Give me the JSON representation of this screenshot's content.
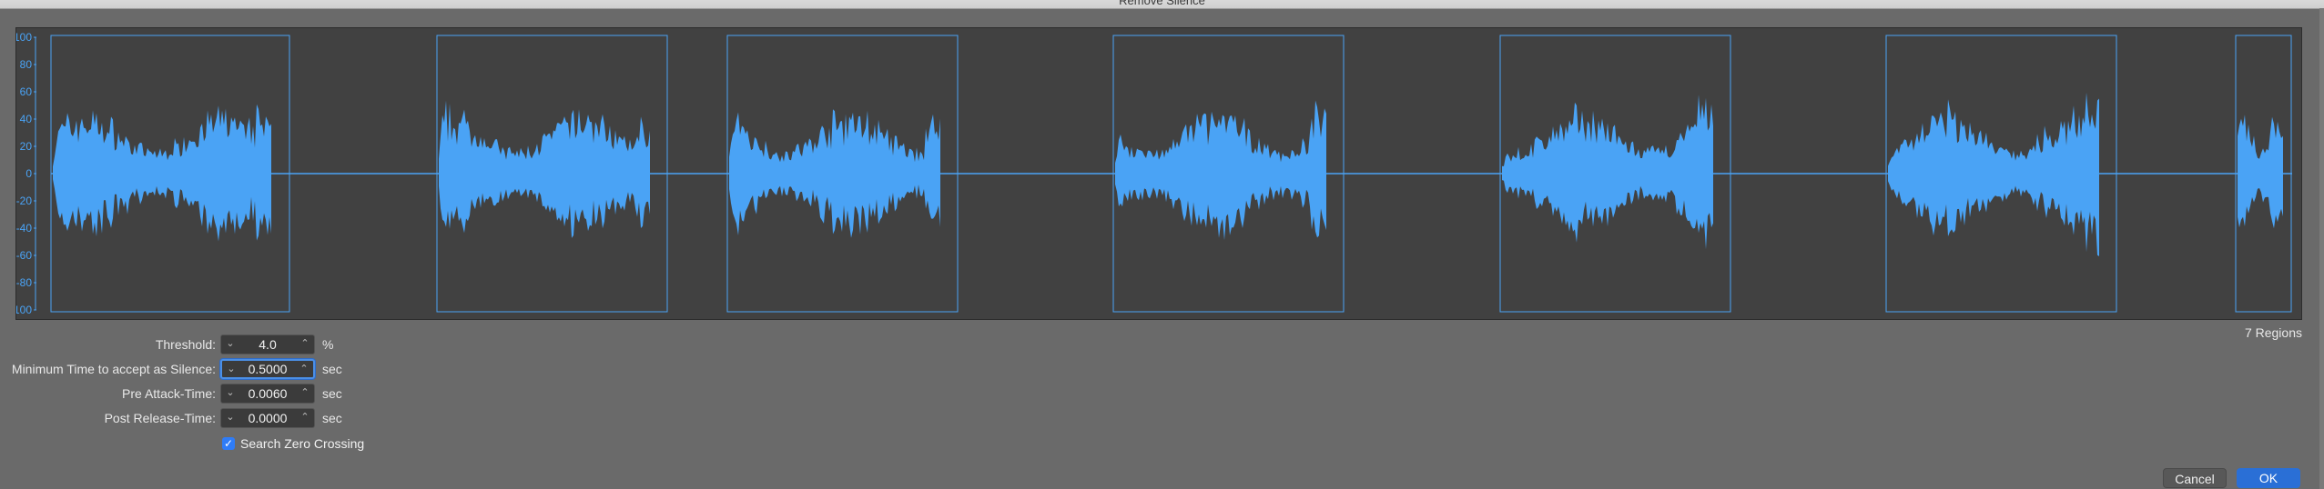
{
  "window": {
    "title": "Remove Silence"
  },
  "waveform": {
    "y_axis_labels": [
      "100",
      "80",
      "60",
      "40",
      "20",
      "0",
      "-20",
      "-40",
      "-60",
      "-80",
      "-100"
    ],
    "colors": {
      "wave": "#4aa3f5",
      "region_border": "#4aa3f5",
      "background": "#414141"
    },
    "region_count": 7
  },
  "regions_label": "7 Regions",
  "params": {
    "threshold": {
      "label": "Threshold:",
      "value": "4.0",
      "unit": "%"
    },
    "min_silence": {
      "label": "Minimum Time to accept as Silence:",
      "value": "0.5000",
      "unit": "sec"
    },
    "pre_attack": {
      "label": "Pre Attack-Time:",
      "value": "0.0060",
      "unit": "sec"
    },
    "post_release": {
      "label": "Post Release-Time:",
      "value": "0.0000",
      "unit": "sec"
    }
  },
  "search_zero_crossing": {
    "label": "Search Zero Crossing",
    "checked": true
  },
  "buttons": {
    "cancel": "Cancel",
    "ok": "OK"
  },
  "icons": {
    "stepper_down": "chevron-down-icon",
    "stepper_up": "chevron-up-icon",
    "check": "checkmark-icon"
  }
}
